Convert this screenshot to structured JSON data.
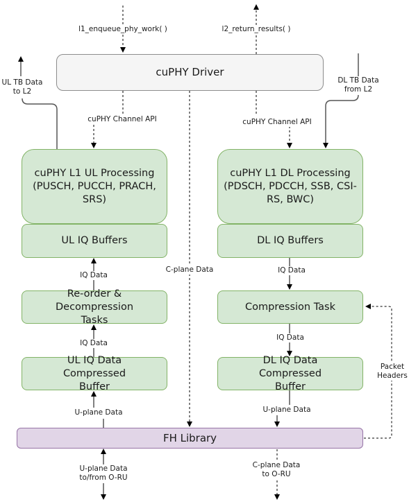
{
  "diagram": {
    "nodes": {
      "driver": "cuPHY Driver",
      "ul_processing": "cuPHY L1 UL Processing (PUSCH, PUCCH, PRACH, SRS)",
      "dl_processing": "cuPHY L1 DL Processing (PDSCH, PDCCH, SSB, CSI-RS, BWC)",
      "ul_iq_buffers": "UL IQ Buffers",
      "dl_iq_buffers": "DL IQ Buffers",
      "reorder_decompression": "Re-order & Decompression Tasks",
      "compression_task": "Compression Task",
      "ul_compressed_buffer": "UL IQ Data Compressed Buffer",
      "dl_compressed_buffer": "DL IQ Data Compressed Buffer",
      "fh_library": "FH Library"
    },
    "edge_labels": {
      "l1_enqueue": "l1_enqueue_phy_work( )",
      "l2_return": "l2_return_results( )",
      "ul_tb_data": "UL TB Data to L2",
      "dl_tb_data": "DL TB Data from L2",
      "channel_api_ul": "cuPHY Channel API",
      "channel_api_dl": "cuPHY Channel API",
      "c_plane_data": "C-plane Data",
      "iq_data_ul_1": "IQ Data",
      "iq_data_ul_2": "IQ Data",
      "iq_data_dl_1": "IQ Data",
      "iq_data_dl_2": "IQ Data",
      "u_plane_ul": "U-plane Data",
      "u_plane_dl": "U-plane Data",
      "packet_headers": "Packet Headers",
      "u_plane_oru": "U-plane Data to/from O-RU",
      "c_plane_oru": "C-plane Data to O-RU"
    },
    "colors": {
      "driver_fill": "#f5f5f5",
      "processing_fill": "#d5e8d4",
      "processing_stroke": "#82b366",
      "fh_fill": "#e1d5e7",
      "fh_stroke": "#9673a6"
    }
  }
}
